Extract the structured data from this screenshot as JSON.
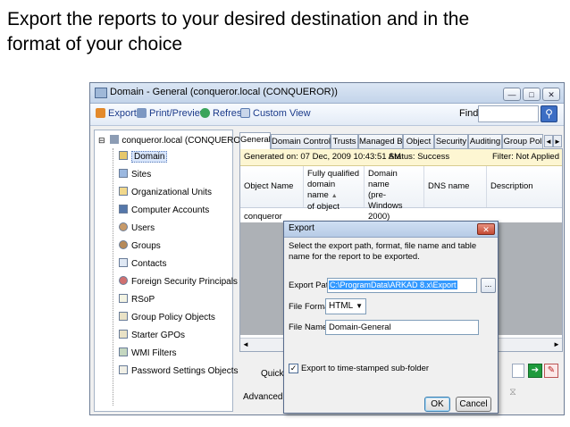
{
  "slide": {
    "title_line1": "Export the reports to your desired destination and in the",
    "title_line2": "format of your choice"
  },
  "window": {
    "title": "Domain - General (conqueror.local (CONQUEROR))",
    "controls": [
      "—",
      "□",
      "✕"
    ]
  },
  "toolbar": {
    "export_label": "Export",
    "print_label": "Print/Preview",
    "refresh_label": "Refresh",
    "custom_view_label": "Custom View",
    "find_label": "Find",
    "find_value": ""
  },
  "tree": {
    "root": "conqueror.local (CONQUEROR)",
    "items": [
      {
        "label": "Domain",
        "selected": true
      },
      {
        "label": "Sites"
      },
      {
        "label": "Organizational Units"
      },
      {
        "label": "Computer Accounts"
      },
      {
        "label": "Users"
      },
      {
        "label": "Groups"
      },
      {
        "label": "Contacts"
      },
      {
        "label": "Foreign Security Principals"
      },
      {
        "label": "RSoP"
      },
      {
        "label": "Group Policy Objects"
      },
      {
        "label": "Starter GPOs"
      },
      {
        "label": "WMI Filters"
      },
      {
        "label": "Password Settings Objects"
      }
    ]
  },
  "tabs": [
    {
      "label": "General",
      "active": true
    },
    {
      "label": "Domain Controllers"
    },
    {
      "label": "Trusts"
    },
    {
      "label": "Managed By"
    },
    {
      "label": "Object"
    },
    {
      "label": "Security"
    },
    {
      "label": "Auditing"
    },
    {
      "label": "Group Pol"
    }
  ],
  "tab_scroll": {
    "left": "◄",
    "right": "►"
  },
  "info_bar": {
    "generated": "Generated on: 07 Dec, 2009 10:43:51 AM",
    "status": "Status: Success",
    "filter": "Filter: Not Applied"
  },
  "table": {
    "headers": [
      {
        "line1": "Object Name",
        "line2": "",
        "line3": "",
        "line4": ""
      },
      {
        "line1": "Fully qualified",
        "line2": "domain name",
        "line3": "of object",
        "line4": ""
      },
      {
        "line1": "Domain name",
        "line2": "(pre-Windows",
        "line3": "2000)",
        "line4": ""
      },
      {
        "line1": "DNS name",
        "line2": "",
        "line3": "",
        "line4": ""
      },
      {
        "line1": "Description",
        "line2": "",
        "line3": "",
        "line4": ""
      }
    ],
    "row1_cell1": "conqueror"
  },
  "scrollbar": {
    "left": "◄",
    "right": "►"
  },
  "bottom": {
    "quick_label": "Quick F",
    "advanced_label": "Advanced Fil",
    "go_icon": "➔",
    "erase_icon": "✎",
    "filter_icon": "⧖"
  },
  "dialog": {
    "title": "Export",
    "close": "✕",
    "description": "Select the export path, format, file name and table name for the report to be exported.",
    "path_label": "Export Path:",
    "path_value": "C:\\ProgramData\\ARKAD 8.x\\Export",
    "browse_label": "...",
    "format_label": "File Format:",
    "format_value": "HTML",
    "format_dd": "▼",
    "name_label": "File Name:",
    "name_value": "Domain-General",
    "checkbox_label": "Export to time-stamped sub-folder",
    "checkbox_mark": "✓",
    "checkbox_checked": true,
    "ok_label": "OK",
    "cancel_label": "Cancel"
  }
}
